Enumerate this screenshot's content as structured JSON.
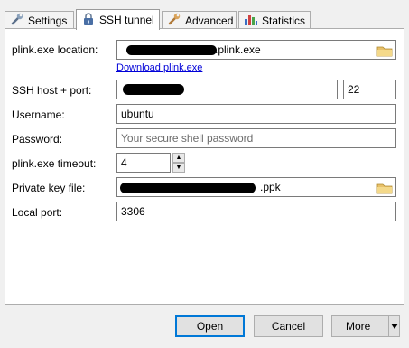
{
  "tabs": [
    {
      "label": "Settings",
      "icon": "wrench-icon",
      "active": false
    },
    {
      "label": "SSH tunnel",
      "icon": "lock-icon",
      "active": true
    },
    {
      "label": "Advanced",
      "icon": "wrench-icon",
      "active": false
    },
    {
      "label": "Statistics",
      "icon": "bar-chart-icon",
      "active": false
    }
  ],
  "form": {
    "plink_location": {
      "label": "plink.exe location:",
      "value": ".plink.exe"
    },
    "download_link": "Download plink.exe",
    "ssh_host": {
      "label": "SSH host + port:",
      "port": "22"
    },
    "username": {
      "label": "Username:",
      "value": "ubuntu"
    },
    "password": {
      "label": "Password:",
      "placeholder": "Your secure shell password"
    },
    "timeout": {
      "label": "plink.exe timeout:",
      "value": "4"
    },
    "private_key": {
      "label": "Private key file:",
      "value": ".ppk"
    },
    "local_port": {
      "label": "Local port:",
      "value": "3306"
    }
  },
  "buttons": {
    "open": "Open",
    "cancel": "Cancel",
    "more": "More"
  },
  "colors": {
    "link": "#0000d8",
    "default_button_border": "#0078d7"
  }
}
